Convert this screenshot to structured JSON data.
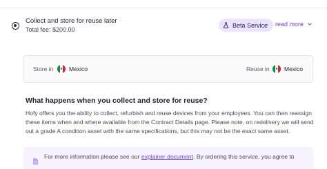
{
  "option": {
    "title": "Collect and store for reuse later",
    "fee": "Total fee: $200.00",
    "badge": "Beta Service",
    "read_more": "read more"
  },
  "locations": {
    "store_label": "Store in",
    "store_value": "Mexico",
    "reuse_label": "Reuse in",
    "reuse_value": "Mexico"
  },
  "section": {
    "title": "What happens when you collect and store for reuse?",
    "body": "Hofy offers you the ability to collect, refurbish and reuse devices from your employees. You can then reassign these items when and where available from the Contract Details page. Please note, on redelivery we will send out a grade A condition asset with the same specifications, but this may not be the exact same asset."
  },
  "info": {
    "text_before": "For more information please see our ",
    "link": "explainer document",
    "text_after": ". By ordering this service, you agree to"
  },
  "colors": {
    "accent": "#6d44d8",
    "badge_bg": "#ece3ff",
    "info_bg": "#f6f3ff"
  },
  "icons": {
    "radio": "radio-selected-icon",
    "badge": "flask-icon",
    "read_more": "chevron-down-icon",
    "flag": "mexico-flag-icon",
    "info": "document-icon"
  }
}
